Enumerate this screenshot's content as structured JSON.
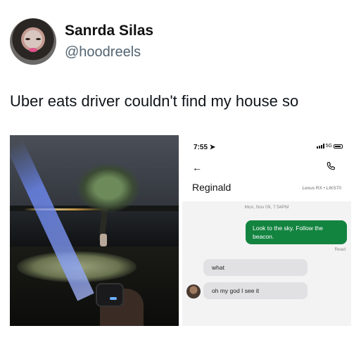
{
  "tweet": {
    "author_name": "Sanrda Silas",
    "author_handle": "@hoodreels",
    "text": "Uber eats driver couldn't find my house so"
  },
  "phone": {
    "status_time": "7:55",
    "status_network": "5G",
    "contact_name": "Reginald",
    "vehicle": "Lexus RX • LIKS70",
    "timestamp": "Mon, Nov 09, 7:54PM",
    "messages": [
      {
        "from": "me",
        "text": "Look to the sky. Follow the beacon."
      },
      {
        "from": "driver",
        "text": "what"
      },
      {
        "from": "driver",
        "text": "oh my god I see it"
      }
    ],
    "read_receipt": "Read",
    "accent_color": "#138440"
  }
}
